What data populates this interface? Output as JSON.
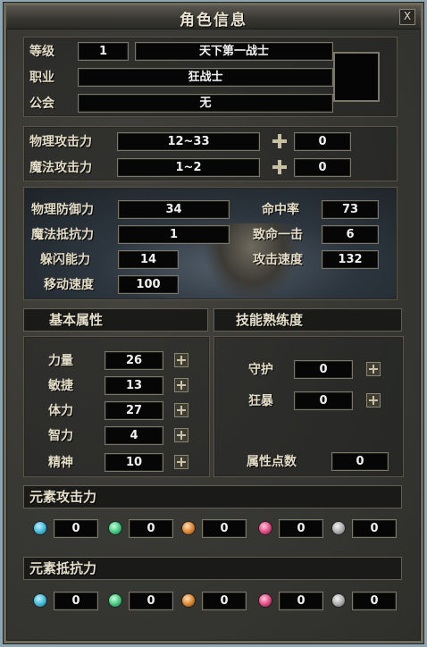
{
  "window": {
    "title": "角色信息",
    "close_glyph": "X"
  },
  "profile": {
    "level_label": "等级",
    "level": "1",
    "title_name": "天下第一战士",
    "job_label": "职业",
    "job": "狂战士",
    "guild_label": "公会",
    "guild": "无"
  },
  "attack": {
    "phys_label": "物理攻击力",
    "phys_value": "12~33",
    "phys_bonus": "0",
    "magic_label": "魔法攻击力",
    "magic_value": "1~2",
    "magic_bonus": "0"
  },
  "defense": {
    "pdef_label": "物理防御力",
    "pdef": "34",
    "mres_label": "魔法抵抗力",
    "mres": "1",
    "dodge_label": "躲闪能力",
    "dodge": "14",
    "move_label": "移动速度",
    "move": "100",
    "hit_label": "命中率",
    "hit": "73",
    "crit_label": "致命一击",
    "crit": "6",
    "aspd_label": "攻击速度",
    "aspd": "132"
  },
  "base_attributes": {
    "header": "基本属性",
    "items": [
      {
        "label": "力量",
        "value": "26"
      },
      {
        "label": "敏捷",
        "value": "13"
      },
      {
        "label": "体力",
        "value": "27"
      },
      {
        "label": "智力",
        "value": "4"
      },
      {
        "label": "精神",
        "value": "10"
      }
    ]
  },
  "skill_mastery": {
    "header": "技能熟练度",
    "guard_label": "守护",
    "guard": "0",
    "berserk_label": "狂暴",
    "berserk": "0",
    "points_label": "属性点数",
    "points": "0"
  },
  "element_attack": {
    "header": "元素攻击力",
    "items": [
      {
        "gem": "blue-gem-icon",
        "color": "#3fb7d6",
        "value": "0"
      },
      {
        "gem": "green-gem-icon",
        "color": "#3ec47a",
        "value": "0"
      },
      {
        "gem": "orange-gem-icon",
        "color": "#d9822b",
        "value": "0"
      },
      {
        "gem": "pink-gem-icon",
        "color": "#e0457e",
        "value": "0"
      },
      {
        "gem": "gray-gem-icon",
        "color": "#a9a9a9",
        "value": "0"
      }
    ]
  },
  "element_resist": {
    "header": "元素抵抗力",
    "items": [
      {
        "gem": "blue-gem-icon",
        "color": "#3fb7d6",
        "value": "0"
      },
      {
        "gem": "green-gem-icon",
        "color": "#3ec47a",
        "value": "0"
      },
      {
        "gem": "orange-gem-icon",
        "color": "#d9822b",
        "value": "0"
      },
      {
        "gem": "pink-gem-icon",
        "color": "#e0457e",
        "value": "0"
      },
      {
        "gem": "gray-gem-icon",
        "color": "#a9a9a9",
        "value": "0"
      }
    ]
  }
}
